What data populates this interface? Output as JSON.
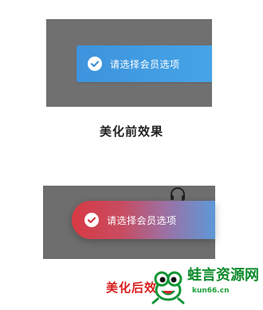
{
  "before": {
    "toast_text": "请选择会员选项",
    "caption": "美化前效果"
  },
  "after": {
    "toast_text": "请选择会员选项",
    "caption": "美化后效"
  },
  "watermark": {
    "main_text": "蛙言资源网",
    "sub_text": "kun66.cn"
  },
  "icons": {
    "check": "check-circle-icon",
    "headset": "headset-icon",
    "frog": "frog-logo-icon"
  },
  "colors": {
    "before_toast_start": "#3d93dd",
    "before_toast_end": "#46a4e7",
    "after_toast_start": "#d83a44",
    "after_toast_end": "#5d98d8",
    "after_caption": "#d81d1d"
  }
}
